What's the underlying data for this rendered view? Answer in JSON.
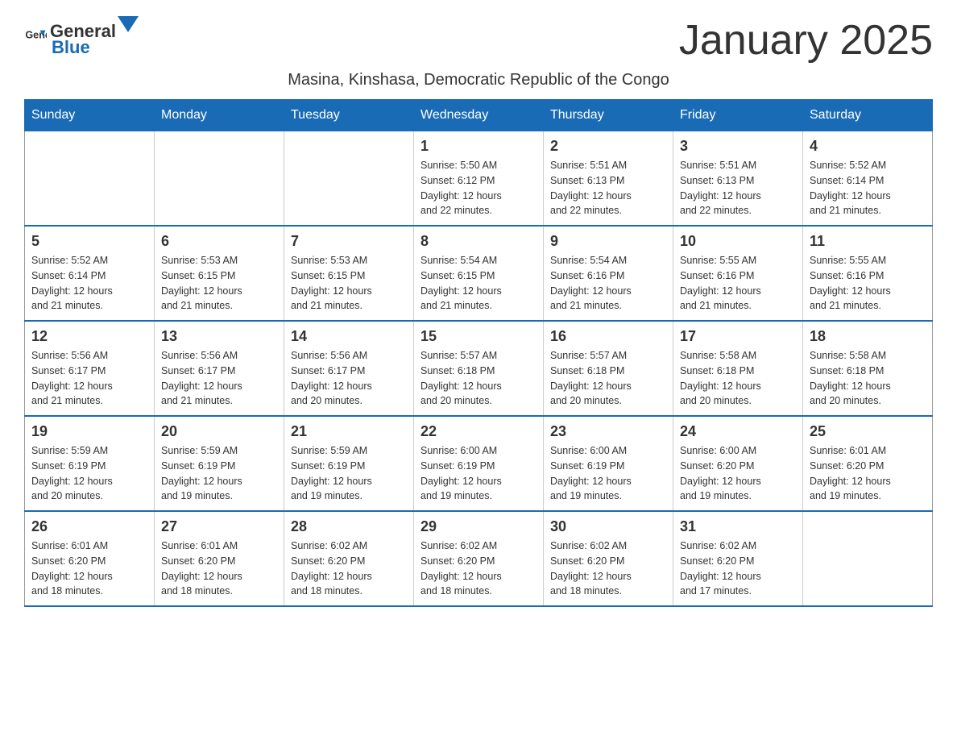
{
  "header": {
    "logo_general": "General",
    "logo_blue": "Blue",
    "month_title": "January 2025",
    "location": "Masina, Kinshasa, Democratic Republic of the Congo"
  },
  "weekdays": [
    "Sunday",
    "Monday",
    "Tuesday",
    "Wednesday",
    "Thursday",
    "Friday",
    "Saturday"
  ],
  "weeks": [
    [
      {
        "day": "",
        "info": ""
      },
      {
        "day": "",
        "info": ""
      },
      {
        "day": "",
        "info": ""
      },
      {
        "day": "1",
        "info": "Sunrise: 5:50 AM\nSunset: 6:12 PM\nDaylight: 12 hours\nand 22 minutes."
      },
      {
        "day": "2",
        "info": "Sunrise: 5:51 AM\nSunset: 6:13 PM\nDaylight: 12 hours\nand 22 minutes."
      },
      {
        "day": "3",
        "info": "Sunrise: 5:51 AM\nSunset: 6:13 PM\nDaylight: 12 hours\nand 22 minutes."
      },
      {
        "day": "4",
        "info": "Sunrise: 5:52 AM\nSunset: 6:14 PM\nDaylight: 12 hours\nand 21 minutes."
      }
    ],
    [
      {
        "day": "5",
        "info": "Sunrise: 5:52 AM\nSunset: 6:14 PM\nDaylight: 12 hours\nand 21 minutes."
      },
      {
        "day": "6",
        "info": "Sunrise: 5:53 AM\nSunset: 6:15 PM\nDaylight: 12 hours\nand 21 minutes."
      },
      {
        "day": "7",
        "info": "Sunrise: 5:53 AM\nSunset: 6:15 PM\nDaylight: 12 hours\nand 21 minutes."
      },
      {
        "day": "8",
        "info": "Sunrise: 5:54 AM\nSunset: 6:15 PM\nDaylight: 12 hours\nand 21 minutes."
      },
      {
        "day": "9",
        "info": "Sunrise: 5:54 AM\nSunset: 6:16 PM\nDaylight: 12 hours\nand 21 minutes."
      },
      {
        "day": "10",
        "info": "Sunrise: 5:55 AM\nSunset: 6:16 PM\nDaylight: 12 hours\nand 21 minutes."
      },
      {
        "day": "11",
        "info": "Sunrise: 5:55 AM\nSunset: 6:16 PM\nDaylight: 12 hours\nand 21 minutes."
      }
    ],
    [
      {
        "day": "12",
        "info": "Sunrise: 5:56 AM\nSunset: 6:17 PM\nDaylight: 12 hours\nand 21 minutes."
      },
      {
        "day": "13",
        "info": "Sunrise: 5:56 AM\nSunset: 6:17 PM\nDaylight: 12 hours\nand 21 minutes."
      },
      {
        "day": "14",
        "info": "Sunrise: 5:56 AM\nSunset: 6:17 PM\nDaylight: 12 hours\nand 20 minutes."
      },
      {
        "day": "15",
        "info": "Sunrise: 5:57 AM\nSunset: 6:18 PM\nDaylight: 12 hours\nand 20 minutes."
      },
      {
        "day": "16",
        "info": "Sunrise: 5:57 AM\nSunset: 6:18 PM\nDaylight: 12 hours\nand 20 minutes."
      },
      {
        "day": "17",
        "info": "Sunrise: 5:58 AM\nSunset: 6:18 PM\nDaylight: 12 hours\nand 20 minutes."
      },
      {
        "day": "18",
        "info": "Sunrise: 5:58 AM\nSunset: 6:18 PM\nDaylight: 12 hours\nand 20 minutes."
      }
    ],
    [
      {
        "day": "19",
        "info": "Sunrise: 5:59 AM\nSunset: 6:19 PM\nDaylight: 12 hours\nand 20 minutes."
      },
      {
        "day": "20",
        "info": "Sunrise: 5:59 AM\nSunset: 6:19 PM\nDaylight: 12 hours\nand 19 minutes."
      },
      {
        "day": "21",
        "info": "Sunrise: 5:59 AM\nSunset: 6:19 PM\nDaylight: 12 hours\nand 19 minutes."
      },
      {
        "day": "22",
        "info": "Sunrise: 6:00 AM\nSunset: 6:19 PM\nDaylight: 12 hours\nand 19 minutes."
      },
      {
        "day": "23",
        "info": "Sunrise: 6:00 AM\nSunset: 6:19 PM\nDaylight: 12 hours\nand 19 minutes."
      },
      {
        "day": "24",
        "info": "Sunrise: 6:00 AM\nSunset: 6:20 PM\nDaylight: 12 hours\nand 19 minutes."
      },
      {
        "day": "25",
        "info": "Sunrise: 6:01 AM\nSunset: 6:20 PM\nDaylight: 12 hours\nand 19 minutes."
      }
    ],
    [
      {
        "day": "26",
        "info": "Sunrise: 6:01 AM\nSunset: 6:20 PM\nDaylight: 12 hours\nand 18 minutes."
      },
      {
        "day": "27",
        "info": "Sunrise: 6:01 AM\nSunset: 6:20 PM\nDaylight: 12 hours\nand 18 minutes."
      },
      {
        "day": "28",
        "info": "Sunrise: 6:02 AM\nSunset: 6:20 PM\nDaylight: 12 hours\nand 18 minutes."
      },
      {
        "day": "29",
        "info": "Sunrise: 6:02 AM\nSunset: 6:20 PM\nDaylight: 12 hours\nand 18 minutes."
      },
      {
        "day": "30",
        "info": "Sunrise: 6:02 AM\nSunset: 6:20 PM\nDaylight: 12 hours\nand 18 minutes."
      },
      {
        "day": "31",
        "info": "Sunrise: 6:02 AM\nSunset: 6:20 PM\nDaylight: 12 hours\nand 17 minutes."
      },
      {
        "day": "",
        "info": ""
      }
    ]
  ]
}
